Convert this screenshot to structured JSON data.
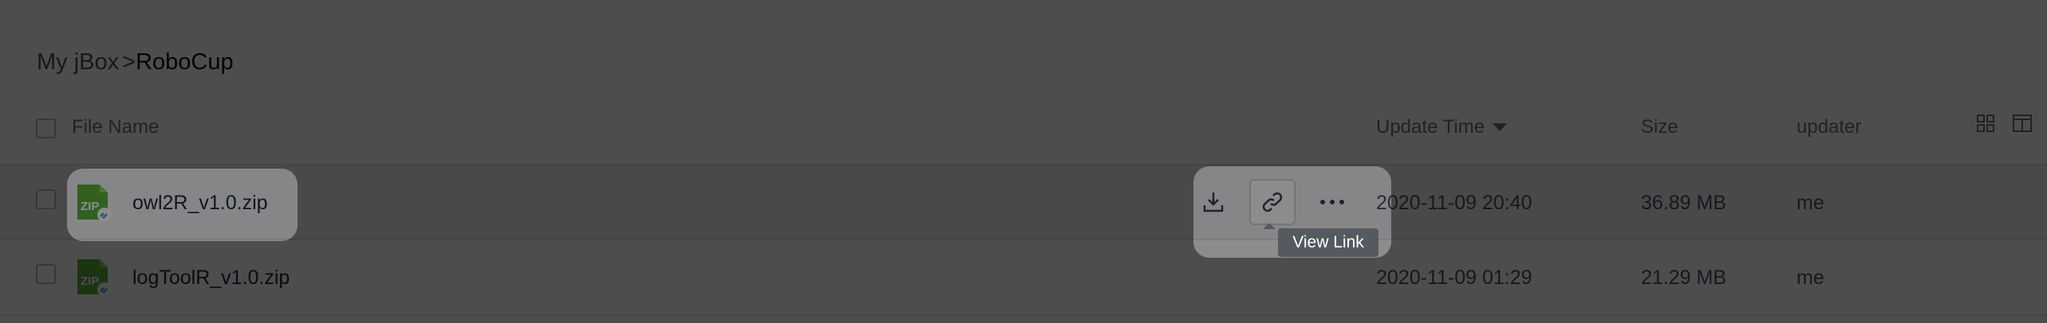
{
  "breadcrumb": {
    "root": "My jBox",
    "separator": ">",
    "current": "RoboCup"
  },
  "table": {
    "columns": {
      "name": "File Name",
      "update_time": "Update Time",
      "size": "Size",
      "updater": "updater"
    },
    "sort": {
      "column": "update_time",
      "direction": "descending"
    },
    "rows": [
      {
        "name": "owl2R_v1.0.zip",
        "update_time": "2020-11-09 20:40",
        "size": "36.89 MB",
        "updater": "me",
        "icon": "zip-file-icon"
      },
      {
        "name": "logToolR_v1.0.zip",
        "update_time": "2020-11-09 01:29",
        "size": "21.29 MB",
        "updater": "me",
        "icon": "zip-file-icon"
      }
    ]
  },
  "row_actions": {
    "items": [
      {
        "name": "download",
        "icon": "download-icon"
      },
      {
        "name": "view-link",
        "icon": "link-icon",
        "selected": true
      },
      {
        "name": "more",
        "icon": "more-icon"
      }
    ],
    "tooltip": "View Link"
  },
  "view_toggle": {
    "grid_icon": "grid-view-icon",
    "panel_icon": "detail-panel-icon"
  },
  "colors": {
    "zip_green": "#5bb03d",
    "zip_dark_green": "#3f8b28",
    "overlay": "rgba(0,0,0,0.45)",
    "tooltip_bg": "#555a60"
  }
}
